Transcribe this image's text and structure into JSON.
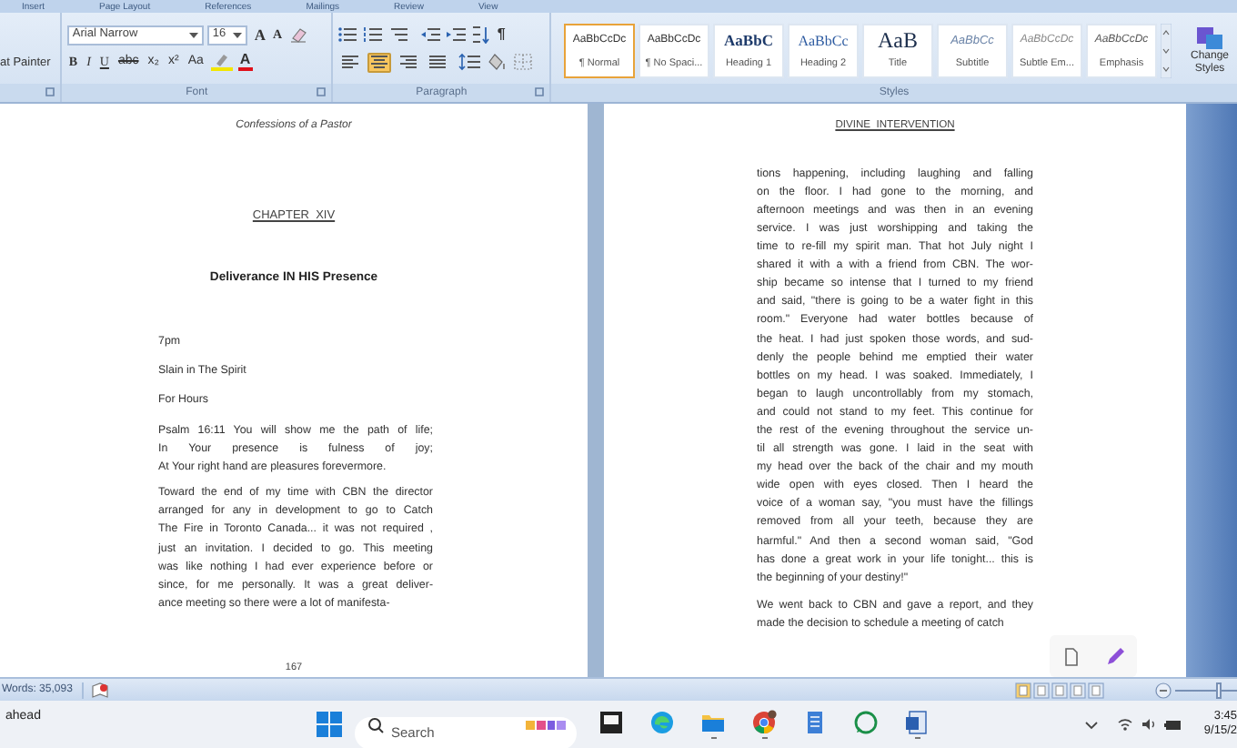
{
  "ribbon_tabs": [
    "Insert",
    "Page Layout",
    "References",
    "Mailings",
    "Review",
    "View"
  ],
  "clipboard": {
    "format_painter": "at Painter"
  },
  "font": {
    "label": "Font",
    "name": "Arial Narrow",
    "size": "16",
    "grow_font": "A",
    "shrink_font": "A",
    "format_buttons": [
      {
        "label": "B",
        "kind": "bold"
      },
      {
        "label": "I",
        "kind": "italic"
      },
      {
        "label": "U",
        "kind": "underline"
      },
      {
        "label": "abc",
        "kind": "strike"
      },
      {
        "label": "x₂",
        "kind": "plain"
      },
      {
        "label": "x²",
        "kind": "plain"
      },
      {
        "label": "Aa",
        "kind": "plain"
      }
    ],
    "font_color": "A"
  },
  "paragraph": {
    "label": "Paragraph",
    "pilcrow": "¶",
    "alignments": [
      {
        "selected": false
      },
      {
        "selected": true
      },
      {
        "selected": false
      },
      {
        "selected": false
      }
    ]
  },
  "styles": {
    "label": "Styles",
    "change_styles": "Change Styles",
    "items": [
      {
        "preview": "AaBbCcDc",
        "name": "¶ Normal",
        "kind": "normal",
        "selected": true
      },
      {
        "preview": "AaBbCcDc",
        "name": "¶ No Spaci...",
        "kind": "normal",
        "selected": false
      },
      {
        "preview": "AaBbC",
        "name": "Heading 1",
        "kind": "heading1",
        "selected": false
      },
      {
        "preview": "AaBbCc",
        "name": "Heading 2",
        "kind": "heading2",
        "selected": false
      },
      {
        "preview": "AaB",
        "name": "Title",
        "kind": "title",
        "selected": false
      },
      {
        "preview": "AaBbCc",
        "name": "Subtitle",
        "kind": "subtitle",
        "selected": false
      },
      {
        "preview": "AaBbCcDc",
        "name": "Subtle Em...",
        "kind": "subtle",
        "selected": false
      },
      {
        "preview": "AaBbCcDc",
        "name": "Emphasis",
        "kind": "emphasis",
        "selected": false
      }
    ]
  },
  "page_1": {
    "header": "Confessions of a Pastor",
    "chapter": "CHAPTER  XIV",
    "title": "Deliverance IN HIS Presence",
    "short_lines": [
      "7pm",
      "Slain in The Spirit",
      "For Hours"
    ],
    "paragraphs": [
      [
        "Psalm 16:11 You will show me the path of life;",
        "In Your presence is fulness of joy;",
        "At Your right hand are pleasures forevermore."
      ],
      [
        "Toward the end of my time with CBN the director",
        "arranged for any in development to go to Catch",
        "The Fire in Toronto Canada... it was not required ,",
        "just an invitation.  I decided to go.  This meeting",
        "was like nothing I had ever experience before or",
        "since, for me personally.  It was a great deliver-",
        "ance meeting so there were a lot of manifesta-"
      ]
    ],
    "page_number": "167"
  },
  "page_2": {
    "header": "DIVINE  INTERVENTION",
    "paragraphs": [
      [
        "tions happening, including laughing and falling",
        "on the floor. I had gone to the morning, and",
        "afternoon meetings and was then in an evening",
        "service. I was just worshipping and taking the",
        "time to re-fill my spirit man. That hot July night I",
        "shared it with a with a friend from CBN.  The wor-",
        "ship became so intense that I turned to my friend",
        "and said, \"there is going to be a water fight in this",
        "room.\"  Everyone had water bottles because of",
        "the heat. I had just spoken those words, and sud-",
        "denly the people behind me emptied their water",
        "bottles on my head. I was soaked.  Immediately, I",
        "began to laugh uncontrollably from my stomach,",
        "and could not stand to my feet. This continue for",
        "the rest of the evening throughout the service un-",
        "til all strength was gone. I laid in the seat with",
        "my head over the back of the chair and my mouth",
        "wide open with eyes closed.  Then I heard the",
        "voice of a woman say, \"you must have the fillings",
        "removed from all your teeth, because they are",
        "harmful.\"  And then a second woman said, \"God",
        "has done a great work in your life tonight... this is",
        "the beginning of your destiny!\""
      ],
      [
        "We went back to CBN and gave a report, and they",
        "made the decision to schedule a meeting of catch"
      ]
    ]
  },
  "status_bar": {
    "words": "Words: 35,093",
    "zoom": {
      "level": 0.6
    }
  },
  "taskbar": {
    "weather": "ahead",
    "search_placeholder": "Search",
    "apps": [
      {
        "running": false
      },
      {
        "running": false
      },
      {
        "running": true
      },
      {
        "running": true
      },
      {
        "running": false
      },
      {
        "running": false
      },
      {
        "running": true
      }
    ],
    "time": "3:45",
    "date": "9/15/2"
  }
}
